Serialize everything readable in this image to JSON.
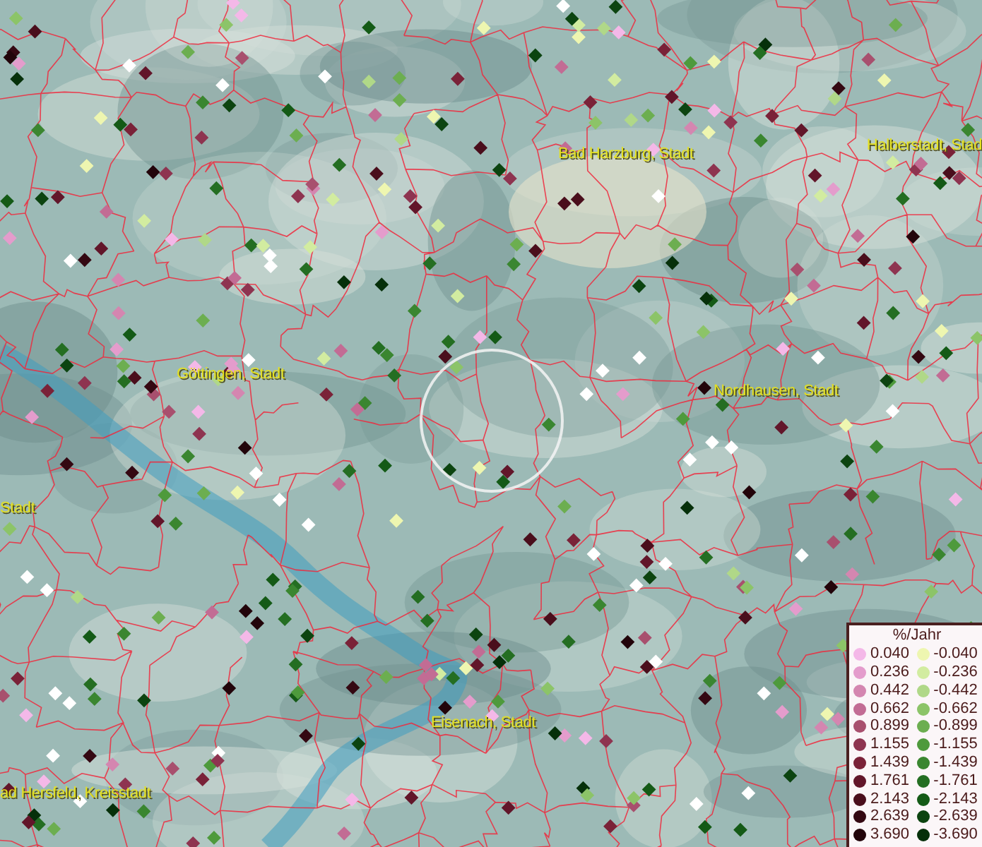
{
  "map": {
    "place_labels": [
      {
        "text": "Bad Harzburg, Stadt"
      },
      {
        "text": "Halberstadt, Stad"
      },
      {
        "text": "Göttingen, Stadt"
      },
      {
        "text": "Nordhausen, Stadt"
      },
      {
        "text": "Stadt"
      },
      {
        "text": "Eisenach, Stadt"
      },
      {
        "text": "ad Hersfeld, Kreisstadt"
      }
    ]
  },
  "legend": {
    "title": "%/Jahr",
    "positive": [
      {
        "label": "0.040",
        "color": "#f4b8e8"
      },
      {
        "label": "0.236",
        "color": "#e49ccc"
      },
      {
        "label": "0.442",
        "color": "#d486b0"
      },
      {
        "label": "0.662",
        "color": "#c26c94"
      },
      {
        "label": "0.899",
        "color": "#a8506e"
      },
      {
        "label": "1.155",
        "color": "#8e3450"
      },
      {
        "label": "1.439",
        "color": "#7a2238"
      },
      {
        "label": "1.761",
        "color": "#62162a"
      },
      {
        "label": "2.143",
        "color": "#4a0e1c"
      },
      {
        "label": "2.639",
        "color": "#340812"
      },
      {
        "label": "3.690",
        "color": "#22040a"
      }
    ],
    "negative": [
      {
        "label": "-0.040",
        "color": "#eef6b0"
      },
      {
        "label": "-0.236",
        "color": "#d2eca0"
      },
      {
        "label": "-0.442",
        "color": "#b0d888"
      },
      {
        "label": "-0.662",
        "color": "#8cc468"
      },
      {
        "label": "-0.899",
        "color": "#6cae50"
      },
      {
        "label": "-1.155",
        "color": "#4e9a3c"
      },
      {
        "label": "-1.439",
        "color": "#3a8630"
      },
      {
        "label": "-1.761",
        "color": "#246e22"
      },
      {
        "label": "-2.143",
        "color": "#145a16"
      },
      {
        "label": "-2.639",
        "color": "#0c4410"
      },
      {
        "label": "-3.690",
        "color": "#06300a"
      }
    ]
  }
}
